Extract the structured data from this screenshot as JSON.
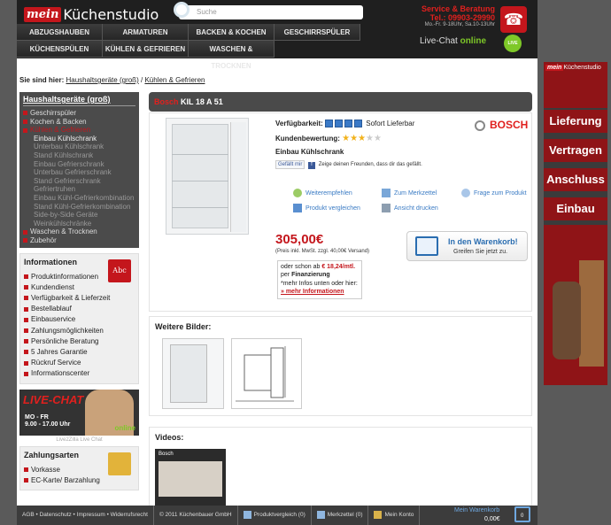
{
  "header": {
    "logo_mein": "mein",
    "logo_brand": "Küchenstudio",
    "search_placeholder": "Suche",
    "service_title": "Service & Beratung",
    "service_phone": "Tel.: 09903-29990",
    "service_hours": "Mo.-Fr. 9-18Uhr, Sa.10-13Uhr",
    "nav_row1": [
      "Abzugshauben",
      "Armaturen",
      "Backen & Kochen",
      "Geschirrspüler"
    ],
    "nav_row2": [
      "Küchenspülen",
      "Kühlen & Gefrieren",
      "Waschen & Trocknen"
    ],
    "livechat_label": "Live-Chat",
    "livechat_status": "online",
    "livechat_icon_text": "LIVE CHAT"
  },
  "breadcrumb": {
    "prefix": "Sie sind hier:",
    "level1": "Haushaltsgeräte (groß)",
    "sep": "/",
    "level2": "Kühlen & Gefrieren"
  },
  "sidebar": {
    "cat_title": "Haushaltsgeräte (groß)",
    "categories": [
      "Geschirrspüler",
      "Kochen & Backen",
      "Kühlen & Gefrieren"
    ],
    "subcats": [
      "Einbau Kühlschrank",
      "Unterbau Kühlschrank",
      "Stand Kühlschrank",
      "Einbau Gefrierschrank",
      "Unterbau Gefrierschrank",
      "Stand Gefrierschrank",
      "Gefriertruhen",
      "Einbau Kühl-Gefrierkombination",
      "Stand Kühl-Gefrierkombination",
      "Side-by-Side Geräte",
      "Weinkühlschränke"
    ],
    "categories_after": [
      "Waschen & Trocknen",
      "Zubehör"
    ],
    "info_title": "Informationen",
    "info_icon_text": "Abc",
    "info_items": [
      "Produktinformationen",
      "Kundendienst",
      "Verfügbarkeit & Lieferzeit",
      "Bestellablauf",
      "Einbauservice",
      "Zahlungsmöglichkeiten",
      "Persönliche Beratung",
      "5 Jahres Garantie",
      "Rückruf Service",
      "Informationscenter"
    ],
    "live_title": "LIVE-CHAT",
    "live_hours1": "MO - FR",
    "live_hours2": "9.00 - 17.00 Uhr",
    "live_online": "online",
    "live_caption": "Live2Zilla Live Chat",
    "pay_title": "Zahlungsarten",
    "pay_items": [
      "Vorkasse",
      "EC-Karte/ Barzahlung"
    ]
  },
  "product": {
    "brand_tag": "Bosch",
    "model": "KIL 18 A 51",
    "availability_label": "Verfügbarkeit:",
    "availability_text": "Sofort Lieferbar",
    "availability_level": 4,
    "rating_label": "Kundenbewertung:",
    "rating": 3,
    "rating_max": 5,
    "type": "Einbau Kühlschrank",
    "manufacturer": "BOSCH",
    "fb_like": "Gefällt mir",
    "fb_text": "Zeige deinen Freunden, dass dir das gefällt.",
    "links": [
      "Weiterempfehlen",
      "Zum Merkzettel",
      "Frage zum Produkt",
      "Produkt vergleichen",
      "Ansicht drucken"
    ],
    "price": "305,00€",
    "price_note": "(Preis inkl. MwSt. zzgl. 40,00€ Versand)",
    "fin_line1": "oder schon ab",
    "fin_rate": "€ 18,24/mtl.",
    "fin_line2": "per",
    "fin_word": "Finanzierung",
    "fin_line3": "*mehr Infos unten oder hier:",
    "fin_link": "» mehr Informationen",
    "cart_title": "In den Warenkorb!",
    "cart_sub": "Greifen Sie jetzt zu."
  },
  "more_images_title": "Weitere Bilder:",
  "videos_title": "Videos:",
  "video_label": "Bosch",
  "right_banner": {
    "logo_mein": "mein",
    "logo_brand": "Küchenstudio",
    "words": [
      "Lieferung",
      "Vertragen",
      "Anschluss",
      "Einbau"
    ]
  },
  "footer": {
    "links": "AGB • Datenschutz • Impressum • Widerrufsrecht",
    "copyright": "© 2011 Küchenbauer GmbH",
    "compare": "Produktvergleich (0)",
    "notes": "Merkzettel (0)",
    "account": "Mein Konto",
    "cart_label": "Mein Warenkorb",
    "cart_value": "0,00€",
    "cart_count": "0"
  },
  "colors": {
    "brand_red": "#c4161c",
    "link_blue": "#3a7bc4",
    "dark": "#1f1f1f"
  }
}
